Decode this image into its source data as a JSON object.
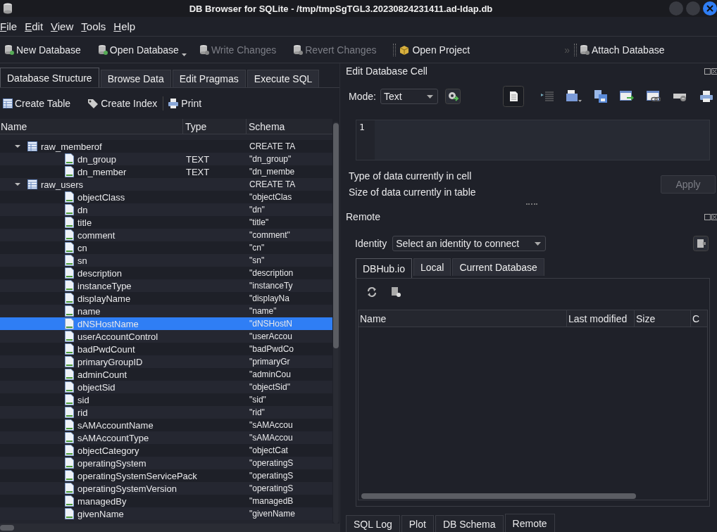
{
  "window": {
    "title": "DB Browser for SQLite - /tmp/tmpSgTGL3.20230824231411.ad-ldap.db"
  },
  "menu": [
    "File",
    "Edit",
    "View",
    "Tools",
    "Help"
  ],
  "toolbar": [
    {
      "label": "New Database",
      "disabled": false,
      "dropdown": false
    },
    {
      "label": "Open Database",
      "disabled": false,
      "dropdown": true
    },
    {
      "label": "Write Changes",
      "disabled": true,
      "dropdown": false
    },
    {
      "label": "Revert Changes",
      "disabled": true,
      "dropdown": false
    },
    {
      "label": "Open Project",
      "disabled": false,
      "dropdown": false
    },
    {
      "label": "Attach Database",
      "disabled": false,
      "dropdown": false
    }
  ],
  "toolbar_more": "»",
  "left_tabs": [
    {
      "label": "Database Structure",
      "selected": true
    },
    {
      "label": "Browse Data",
      "selected": false
    },
    {
      "label": "Edit Pragmas",
      "selected": false
    },
    {
      "label": "Execute SQL",
      "selected": false
    }
  ],
  "structure_tools": [
    "Create Table",
    "Create Index",
    "Print"
  ],
  "tree": {
    "columns": [
      "Name",
      "Type",
      "Schema"
    ],
    "items": [
      {
        "name": "raw_memberof",
        "schema": "CREATE TA",
        "expanded": true,
        "selected": false,
        "children": [
          {
            "name": "dn_group",
            "type": "TEXT",
            "schema": "\"dn_group\"",
            "selected": false
          },
          {
            "name": "dn_member",
            "type": "TEXT",
            "schema": "\"dn_membe",
            "selected": false
          }
        ]
      },
      {
        "name": "raw_users",
        "schema": "CREATE TA",
        "expanded": true,
        "selected": false,
        "children": [
          {
            "name": "objectClass",
            "schema": "\"objectClas",
            "selected": false
          },
          {
            "name": "dn",
            "schema": "\"dn\"",
            "selected": false
          },
          {
            "name": "title",
            "schema": "\"title\"",
            "selected": false
          },
          {
            "name": "comment",
            "schema": "\"comment\"",
            "selected": false
          },
          {
            "name": "cn",
            "schema": "\"cn\"",
            "selected": false
          },
          {
            "name": "sn",
            "schema": "\"sn\"",
            "selected": false
          },
          {
            "name": "description",
            "schema": "\"description",
            "selected": false
          },
          {
            "name": "instanceType",
            "schema": "\"instanceTy",
            "selected": false
          },
          {
            "name": "displayName",
            "schema": "\"displayNa",
            "selected": false
          },
          {
            "name": "name",
            "schema": "\"name\"",
            "selected": false
          },
          {
            "name": "dNSHostName",
            "schema": "\"dNSHostN",
            "selected": true
          },
          {
            "name": "userAccountControl",
            "schema": "\"userAccou",
            "selected": false
          },
          {
            "name": "badPwdCount",
            "schema": "\"badPwdCo",
            "selected": false
          },
          {
            "name": "primaryGroupID",
            "schema": "\"primaryGr",
            "selected": false
          },
          {
            "name": "adminCount",
            "schema": "\"adminCou",
            "selected": false
          },
          {
            "name": "objectSid",
            "schema": "\"objectSid\"",
            "selected": false
          },
          {
            "name": "sid",
            "schema": "\"sid\"",
            "selected": false
          },
          {
            "name": "rid",
            "schema": "\"rid\"",
            "selected": false
          },
          {
            "name": "sAMAccountName",
            "schema": "\"sAMAccou",
            "selected": false
          },
          {
            "name": "sAMAccountType",
            "schema": "\"sAMAccou",
            "selected": false
          },
          {
            "name": "objectCategory",
            "schema": "\"objectCat",
            "selected": false
          },
          {
            "name": "operatingSystem",
            "schema": "\"operatingS",
            "selected": false
          },
          {
            "name": "operatingSystemServicePack",
            "schema": "\"operatingS",
            "selected": false
          },
          {
            "name": "operatingSystemVersion",
            "schema": "\"operatingS",
            "selected": false
          },
          {
            "name": "managedBy",
            "schema": "\"managedB",
            "selected": false
          },
          {
            "name": "givenName",
            "schema": "\"givenName",
            "selected": false
          }
        ]
      }
    ]
  },
  "edit_cell": {
    "title": "Edit Database Cell",
    "mode_label": "Mode:",
    "mode": "Text",
    "line_numbers": [
      "1"
    ],
    "info": [
      "Type of data currently in cell",
      "Size of data currently in table"
    ],
    "apply": {
      "label": "Apply",
      "disabled": true
    }
  },
  "remote": {
    "title": "Remote",
    "identity_label": "Identity",
    "identity": "Select an identity to connect",
    "tabs": [
      {
        "label": "DBHub.io",
        "selected": true
      },
      {
        "label": "Local",
        "selected": false
      },
      {
        "label": "Current Database",
        "selected": false
      }
    ],
    "columns": [
      "Name",
      "Last modified",
      "Size",
      "C"
    ]
  },
  "bottom_tabs": [
    {
      "label": "SQL Log",
      "selected": false
    },
    {
      "label": "Plot",
      "selected": false
    },
    {
      "label": "DB Schema",
      "selected": false
    },
    {
      "label": "Remote",
      "selected": true
    }
  ]
}
